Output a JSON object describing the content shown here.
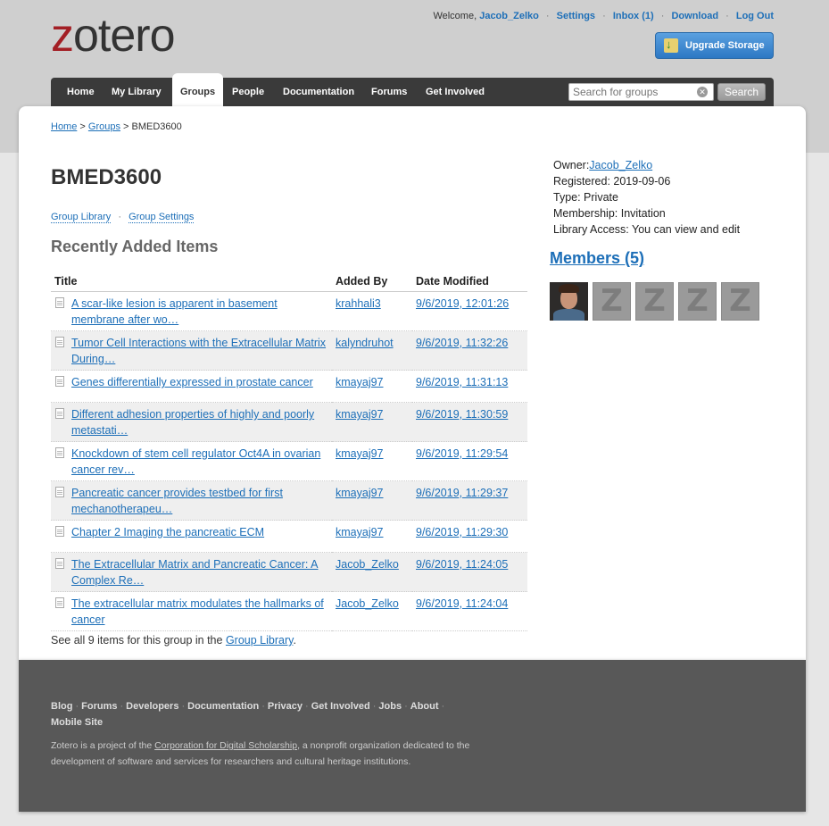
{
  "logo": {
    "first": "z",
    "rest": "otero"
  },
  "usernav": {
    "welcome": "Welcome,",
    "username": "Jacob_Zelko",
    "settings": "Settings",
    "inbox": "Inbox (1)",
    "download": "Download",
    "logout": "Log Out"
  },
  "upgrade": {
    "label": "Upgrade Storage"
  },
  "nav": {
    "tabs": [
      "Home",
      "My Library",
      "Groups",
      "People",
      "Documentation",
      "Forums",
      "Get Involved"
    ],
    "active": "Groups",
    "search_placeholder": "Search for groups",
    "search_button": "Search"
  },
  "breadcrumb": {
    "home": "Home",
    "sep1": " > ",
    "groups": "Groups",
    "sep2": " > ",
    "current": "BMED3600"
  },
  "group": {
    "title": "BMED3600",
    "library_link": "Group Library",
    "settings_link": "Group Settings",
    "recent_title": "Recently Added Items",
    "owner_label": "Owner:",
    "owner": "Jacob_Zelko",
    "registered": "Registered: 2019-09-06",
    "type": "Type: Private",
    "membership": "Membership: Invitation",
    "access": "Library Access: You can view and edit",
    "members_title": "Members (5)"
  },
  "table": {
    "headers": [
      "Title",
      "Added By",
      "Date Modified"
    ],
    "rows": [
      {
        "title": "A scar-like lesion is apparent in basement membrane after wo…",
        "added_by": "krahhali3",
        "date": "9/6/2019, 12:01:26"
      },
      {
        "title": "Tumor Cell Interactions with the Extracellular Matrix During…",
        "added_by": "kalyndruhot",
        "date": "9/6/2019, 11:32:26"
      },
      {
        "title": "Genes differentially expressed in prostate cancer",
        "added_by": "kmayaj97",
        "date": "9/6/2019, 11:31:13"
      },
      {
        "title": "Different adhesion properties of highly and poorly metastati…",
        "added_by": "kmayaj97",
        "date": "9/6/2019, 11:30:59"
      },
      {
        "title": "Knockdown of stem cell regulator Oct4A in ovarian cancer rev…",
        "added_by": "kmayaj97",
        "date": "9/6/2019, 11:29:54"
      },
      {
        "title": "Pancreatic cancer provides testbed for first mechanotherapeu…",
        "added_by": "kmayaj97",
        "date": "9/6/2019, 11:29:37"
      },
      {
        "title": "Chapter 2 Imaging the pancreatic ECM",
        "added_by": "kmayaj97",
        "date": "9/6/2019, 11:29:30"
      },
      {
        "title": "The Extracellular Matrix and Pancreatic Cancer: A Complex Re…",
        "added_by": "Jacob_Zelko",
        "date": "9/6/2019, 11:24:05"
      },
      {
        "title": "The extracellular matrix modulates the hallmarks of cancer",
        "added_by": "Jacob_Zelko",
        "date": "9/6/2019, 11:24:04"
      }
    ]
  },
  "seeall": {
    "before": "See all 9 items for this group in the ",
    "link": "Group Library",
    "after": "."
  },
  "footer": {
    "links": [
      "Blog",
      "Forums",
      "Developers",
      "Documentation",
      "Privacy",
      "Get Involved",
      "Jobs",
      "About",
      "Mobile Site"
    ],
    "note_before": "Zotero is a project of the ",
    "note_link": "Corporation for Digital Scholarship",
    "note_after": ", a nonprofit organization dedicated to the development of software and services for researchers and cultural heritage institutions."
  },
  "colors": {
    "link": "#1d6fb8",
    "logo_red": "#a31f25",
    "nav_bg": "#3a3a3a",
    "footer_bg": "#585858"
  }
}
